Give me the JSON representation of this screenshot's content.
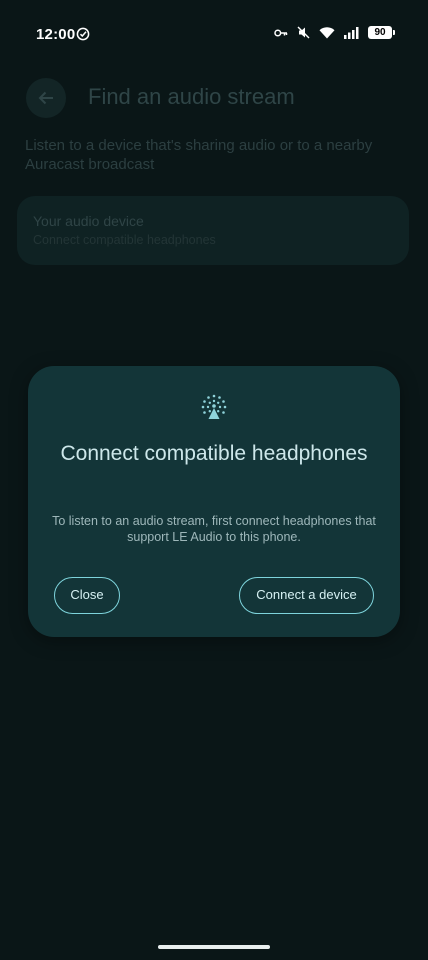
{
  "status_bar": {
    "time": "12:00",
    "battery": "90",
    "icons": [
      "check-circle-icon",
      "key-icon",
      "mute-icon",
      "wifi-icon",
      "signal-icon",
      "battery-icon"
    ]
  },
  "page": {
    "title": "Find an audio stream",
    "description": "Listen to a device that's sharing audio or to a nearby Auracast broadcast",
    "device_card": {
      "title": "Your audio device",
      "subtitle": "Connect compatible headphones"
    }
  },
  "dialog": {
    "title": "Connect compatible headphones",
    "body": "To listen to an audio stream, first connect headphones that support LE Audio to this phone.",
    "close_label": "Close",
    "connect_label": "Connect a device",
    "icon": "broadcast-icon"
  },
  "colors": {
    "background": "#0a1617",
    "dialog": "#133538",
    "accent": "#7ed4dc"
  }
}
